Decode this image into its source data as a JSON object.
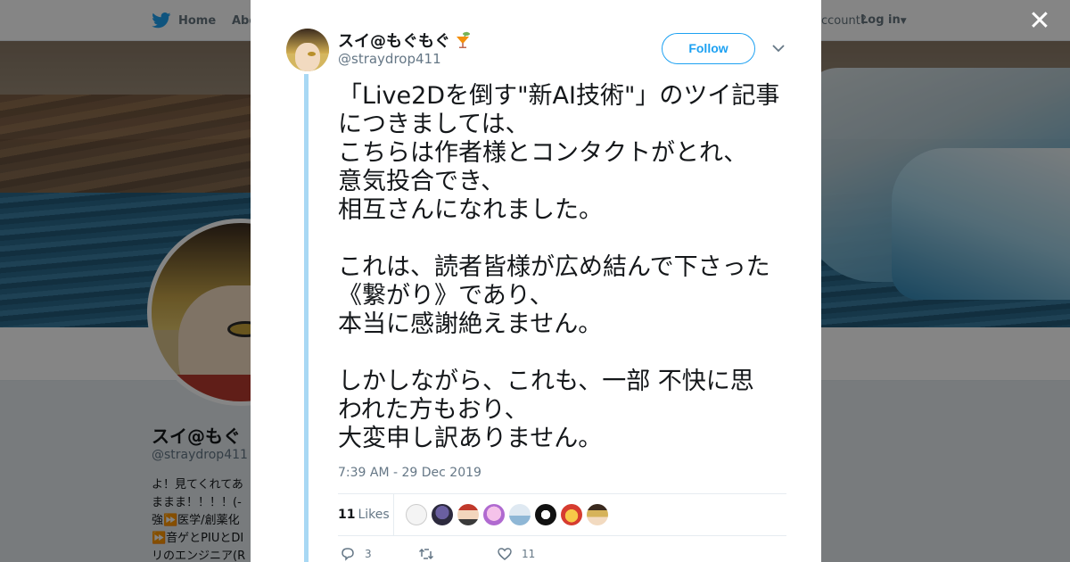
{
  "nav": {
    "home_label": "Home",
    "about_label": "Abo",
    "account_prompt": "ccount?",
    "login_label": "Log in"
  },
  "profile": {
    "name": "スイ@もぐ",
    "handle": "@straydrop411",
    "bio_lines": [
      "よ！見てくれてあ",
      "ままま！！！！(-",
      "強⏩医学/創薬化",
      "⏩音ゲとPIUとDI",
      "リのエンジニア(R"
    ]
  },
  "tweet": {
    "author_name": "スイ@もぐもぐ",
    "author_handle": "@straydrop411",
    "follow_label": "Follow",
    "text": "「Live2Dを倒す\"新AI技術\"」のツイ記事\nにつきましては、\nこちらは作者様とコンタクトがとれ、\n意気投合でき、\n相互さんになれました。\n\nこれは、読者皆様が広め結んで下さった\n《繋がり》であり、\n本当に感謝絶えません。\n\nしかしながら、これも、一部 不快に思\nわれた方もおり、\n大変申し訳ありません。",
    "timestamp": "7:39 AM - 29 Dec 2019",
    "likes_count": "11",
    "likes_label": "Likes",
    "replies_count": "3",
    "retweets_count": "",
    "favorites_count": "11"
  },
  "colors": {
    "accent": "#1da1f2",
    "thread_line": "#a8d8f4",
    "secondary_text": "#657786",
    "overlay": "rgba(0,0,0,0.48)"
  },
  "icons": {
    "bird": "twitter-bird-icon",
    "close": "close-icon",
    "caret": "chevron-down-icon",
    "reply": "reply-icon",
    "retweet": "retweet-icon",
    "like": "heart-icon",
    "emoji": "tropical-drink-emoji-icon"
  }
}
